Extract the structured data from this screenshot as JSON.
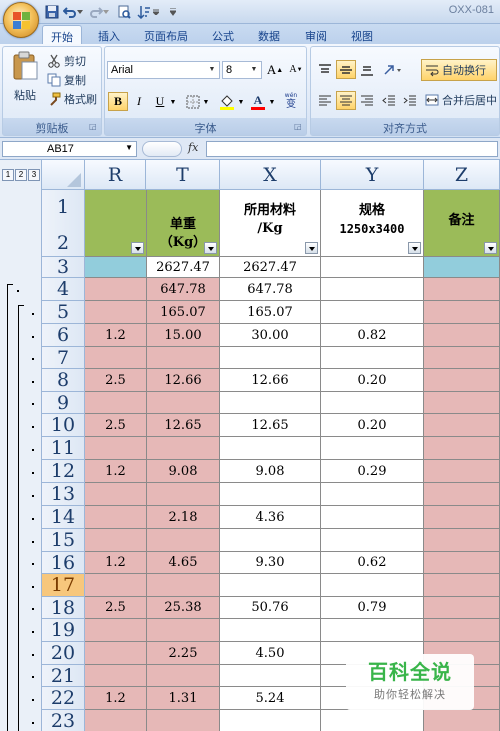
{
  "window": {
    "title": "OXX-081"
  },
  "tabs": [
    "开始",
    "插入",
    "页面布局",
    "公式",
    "数据",
    "审阅",
    "视图"
  ],
  "ribbon": {
    "clipboard": {
      "paste": "粘贴",
      "cut": "剪切",
      "copy": "复制",
      "format_painter": "格式刷",
      "label": "剪贴板"
    },
    "font": {
      "name": "Arial",
      "size": "8",
      "grow": "A",
      "shrink": "A",
      "bold": "B",
      "italic": "I",
      "underline": "U",
      "color_a": "A",
      "phonetic": "变",
      "label": "字体"
    },
    "alignment": {
      "wrap_text": "自动换行",
      "merge_center": "合并后居中",
      "label": "对齐方式"
    }
  },
  "formula_bar": {
    "name_box": "AB17",
    "fx": "fx",
    "formula": ""
  },
  "outline_levels": [
    "1",
    "2",
    "3"
  ],
  "columns": [
    "R",
    "T",
    "X",
    "Y",
    "Z"
  ],
  "header": {
    "T_line1": "单重",
    "T_line2": "（Kg）",
    "X_line1": "所用材料",
    "X_line2": "/Kg",
    "Y_line1": "规格",
    "Y_line2": "1250x3400",
    "Z": "备注"
  },
  "rows": [
    {
      "num": "1"
    },
    {
      "num": "2"
    },
    {
      "num": "3",
      "R": "",
      "T": "2627.47",
      "X": "2627.47",
      "Y": ""
    },
    {
      "num": "4",
      "R": "",
      "T": "647.78",
      "X": "647.78",
      "Y": ""
    },
    {
      "num": "5",
      "R": "",
      "T": "165.07",
      "X": "165.07",
      "Y": ""
    },
    {
      "num": "6",
      "R": "1.2",
      "T": "15.00",
      "X": "30.00",
      "Y": "0.82"
    },
    {
      "num": "7",
      "R": "",
      "T": "",
      "X": "",
      "Y": ""
    },
    {
      "num": "8",
      "R": "2.5",
      "T": "12.66",
      "X": "12.66",
      "Y": "0.20"
    },
    {
      "num": "9",
      "R": "",
      "T": "",
      "X": "",
      "Y": ""
    },
    {
      "num": "10",
      "R": "2.5",
      "T": "12.65",
      "X": "12.65",
      "Y": "0.20"
    },
    {
      "num": "11",
      "R": "",
      "T": "",
      "X": "",
      "Y": ""
    },
    {
      "num": "12",
      "R": "1.2",
      "T": "9.08",
      "X": "9.08",
      "Y": "0.29"
    },
    {
      "num": "13",
      "R": "",
      "T": "",
      "X": "",
      "Y": ""
    },
    {
      "num": "14",
      "R": "",
      "T": "2.18",
      "X": "4.36",
      "Y": ""
    },
    {
      "num": "15",
      "R": "",
      "T": "",
      "X": "",
      "Y": ""
    },
    {
      "num": "16",
      "R": "1.2",
      "T": "4.65",
      "X": "9.30",
      "Y": "0.62"
    },
    {
      "num": "17",
      "R": "",
      "T": "",
      "X": "",
      "Y": ""
    },
    {
      "num": "18",
      "R": "2.5",
      "T": "25.38",
      "X": "50.76",
      "Y": "0.79"
    },
    {
      "num": "19",
      "R": "",
      "T": "",
      "X": "",
      "Y": ""
    },
    {
      "num": "20",
      "R": "",
      "T": "2.25",
      "X": "4.50",
      "Y": ""
    },
    {
      "num": "21",
      "R": "",
      "T": "",
      "X": "",
      "Y": ""
    },
    {
      "num": "22",
      "R": "1.2",
      "T": "1.31",
      "X": "5.24",
      "Y": ""
    },
    {
      "num": "23",
      "R": "",
      "T": "",
      "X": "",
      "Y": ""
    }
  ],
  "selected_row": "17",
  "watermark": {
    "title": "百科全说",
    "subtitle": "助你轻松解决"
  },
  "colors": {
    "pink": "#e6b8b7",
    "green": "#9bbb59",
    "blue": "#92cddc",
    "selected_row": "#f7c77c"
  }
}
